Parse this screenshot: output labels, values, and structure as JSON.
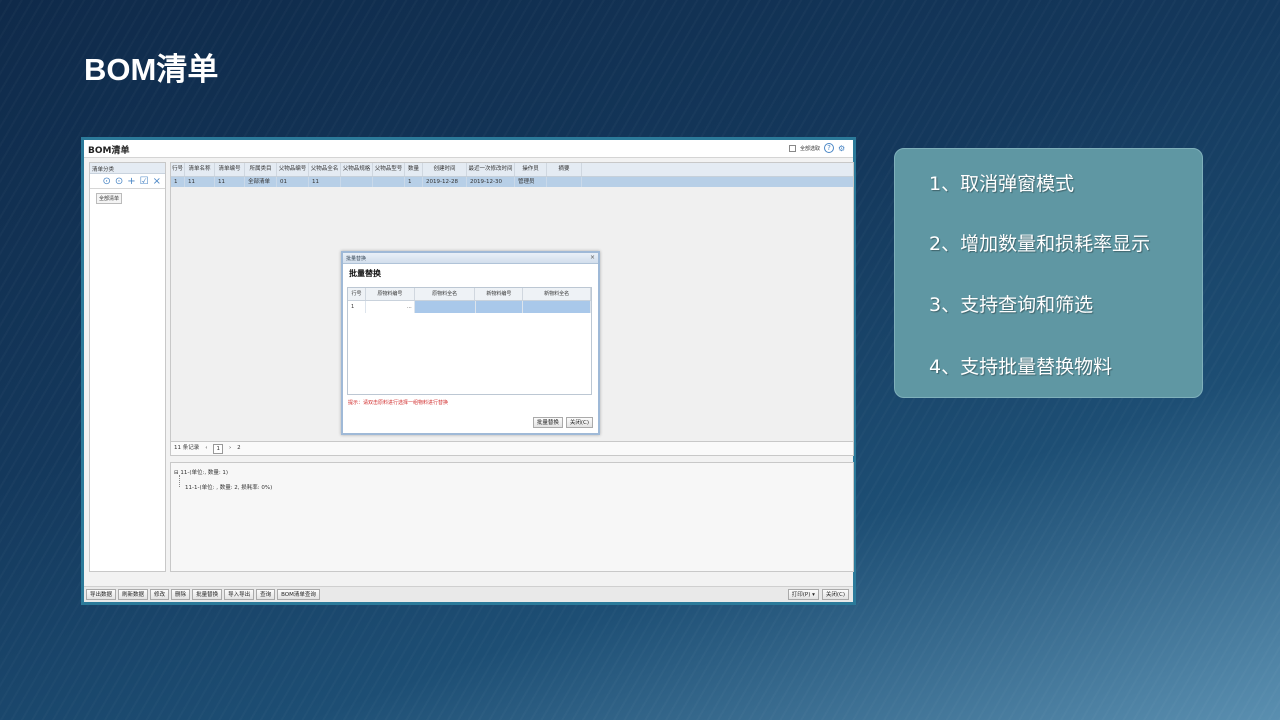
{
  "slide": {
    "title": "BOM清单"
  },
  "app": {
    "window_title": "BOM清单",
    "top_right_checkbox_label": "全部选取",
    "left_panel": {
      "header": "清单分类",
      "tools": [
        "⊙",
        "⊙",
        "+",
        "☑",
        "×"
      ],
      "tag": "全部清单"
    },
    "grid": {
      "columns": [
        "行号",
        "清单名称",
        "清单编号",
        "所属类目",
        "父物品编号",
        "父物品全名",
        "父物品规格",
        "父物品型号",
        "数量",
        "创建时间",
        "最近一次修改时间",
        "操作员",
        "摘要"
      ],
      "rows": [
        [
          "1",
          "11",
          "11",
          "全部清单",
          "01",
          "11",
          "",
          "",
          "1",
          "2019-12-28",
          "2019-12-30",
          "管理员",
          ""
        ]
      ]
    },
    "pager": {
      "count_text": "11 条记录",
      "prev": "‹",
      "current_page": "1",
      "next": "›",
      "total": "2"
    },
    "tree": {
      "node1": "⊟ 11-(单位:, 数量: 1)",
      "node2": "11-1-(单位: , 数量: 2, 损耗率: 0%)"
    },
    "bottom_buttons": [
      "导出数据",
      "刷新数据",
      "修改",
      "删除",
      "批量替换",
      "导入导出",
      "查询",
      "BOM清单查询"
    ],
    "bottom_right_buttons": [
      "打印(P) ▾",
      "关闭(C)"
    ],
    "dialog": {
      "title": "批量替换",
      "heading": "批量替换",
      "columns": [
        "行号",
        "原物料编号",
        "原物料全名",
        "新物料编号",
        "新物料全名"
      ],
      "row": [
        "1",
        "...",
        "",
        "",
        ""
      ],
      "hint": "提示：请双击原料进行选择一组物料进行替换",
      "buttons": [
        "批量替换",
        "关闭(C)"
      ]
    }
  },
  "features": [
    "1、取消弹窗模式",
    "2、增加数量和损耗率显示",
    "3、支持查询和筛选",
    "4、支持批量替换物料"
  ]
}
